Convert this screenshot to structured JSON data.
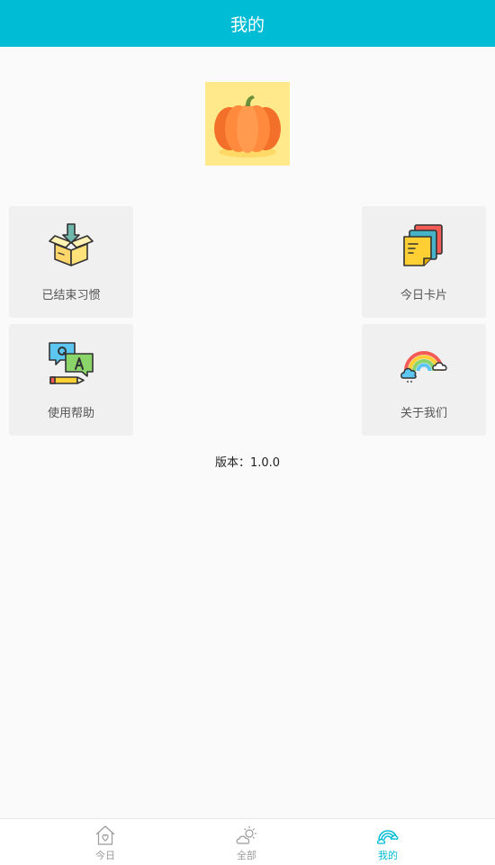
{
  "header": {
    "title": "我的"
  },
  "logo": {
    "icon": "pumpkin-icon"
  },
  "cards": {
    "ended_habits": {
      "label": "已结束习惯",
      "icon": "open-box-icon"
    },
    "today_cards": {
      "label": "今日卡片",
      "icon": "sticky-notes-icon"
    },
    "help": {
      "label": "使用帮助",
      "icon": "qa-icon"
    },
    "about": {
      "label": "关于我们",
      "icon": "rainbow-icon"
    }
  },
  "version": {
    "text": "版本：1.0.0"
  },
  "tabbar": {
    "tabs": [
      {
        "label": "今日",
        "icon": "house-heart-icon",
        "active": false
      },
      {
        "label": "全部",
        "icon": "sun-cloud-icon",
        "active": false
      },
      {
        "label": "我的",
        "icon": "rainbow-icon",
        "active": true
      }
    ]
  },
  "colors": {
    "accent": "#00bcd4",
    "background": "#fafafa",
    "card_background": "#f0f0f0",
    "tab_inactive": "#9a9a9a"
  }
}
